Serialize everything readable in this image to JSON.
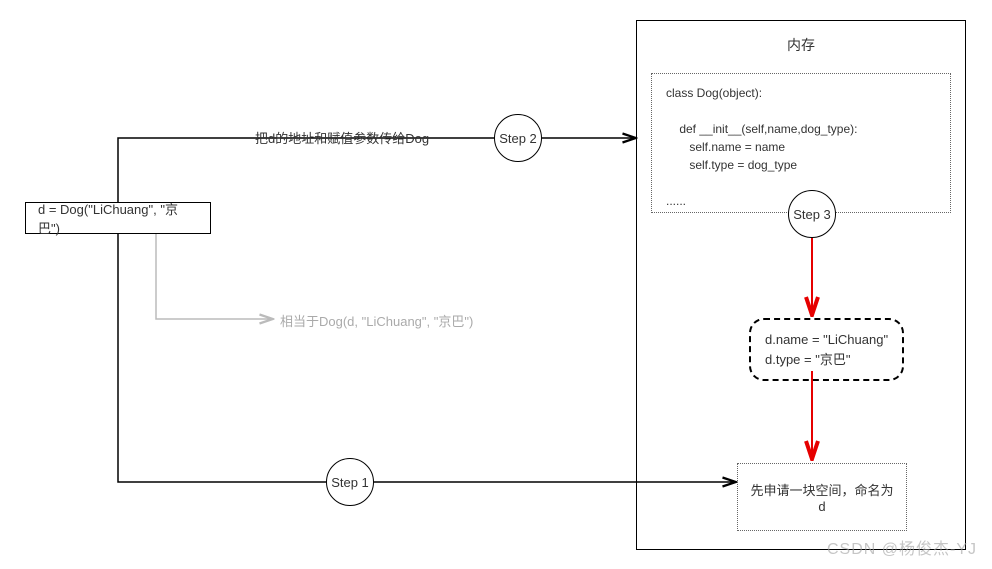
{
  "nodes": {
    "instantiation": "d = Dog(\"LiChuang\", \"京巴\")",
    "step1": "Step 1",
    "step2": "Step 2",
    "step3": "Step 3",
    "memory_title": "内存",
    "class_code": "class Dog(object):\n\n    def __init__(self,name,dog_type):\n       self.name = name\n       self.type = dog_type\n\n......",
    "result_code": "d.name = \"LiChuang\"\nd.type = \"京巴\"",
    "allocate_space": "先申请一块空间，命名为d"
  },
  "edges": {
    "label_step2": "把d的地址和赋值参数传给Dog",
    "label_equivalent": "相当于Dog(d, \"LiChuang\", \"京巴\")"
  },
  "footer": {
    "watermark": "CSDN @杨俊杰-YJ"
  }
}
